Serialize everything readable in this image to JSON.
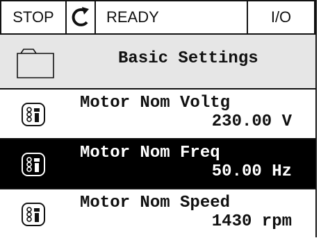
{
  "status": {
    "stop": "STOP",
    "rotation_icon": "rotation-arrow-icon",
    "state": "READY",
    "control": "I/O"
  },
  "header": {
    "icon": "folder-icon",
    "title": "Basic Settings"
  },
  "params": [
    {
      "name": "Motor Nom Voltg",
      "value": "230.00 V",
      "icon": "parameter-icon",
      "selected": false
    },
    {
      "name": "Motor Nom Freq",
      "value": "50.00 Hz",
      "icon": "parameter-icon",
      "selected": true
    },
    {
      "name": "Motor Nom Speed",
      "value": "1430 rpm",
      "icon": "parameter-icon",
      "selected": false
    }
  ],
  "colors": {
    "selected_bg": "#000000",
    "header_bg": "#e6e6e6",
    "text": "#111111"
  }
}
